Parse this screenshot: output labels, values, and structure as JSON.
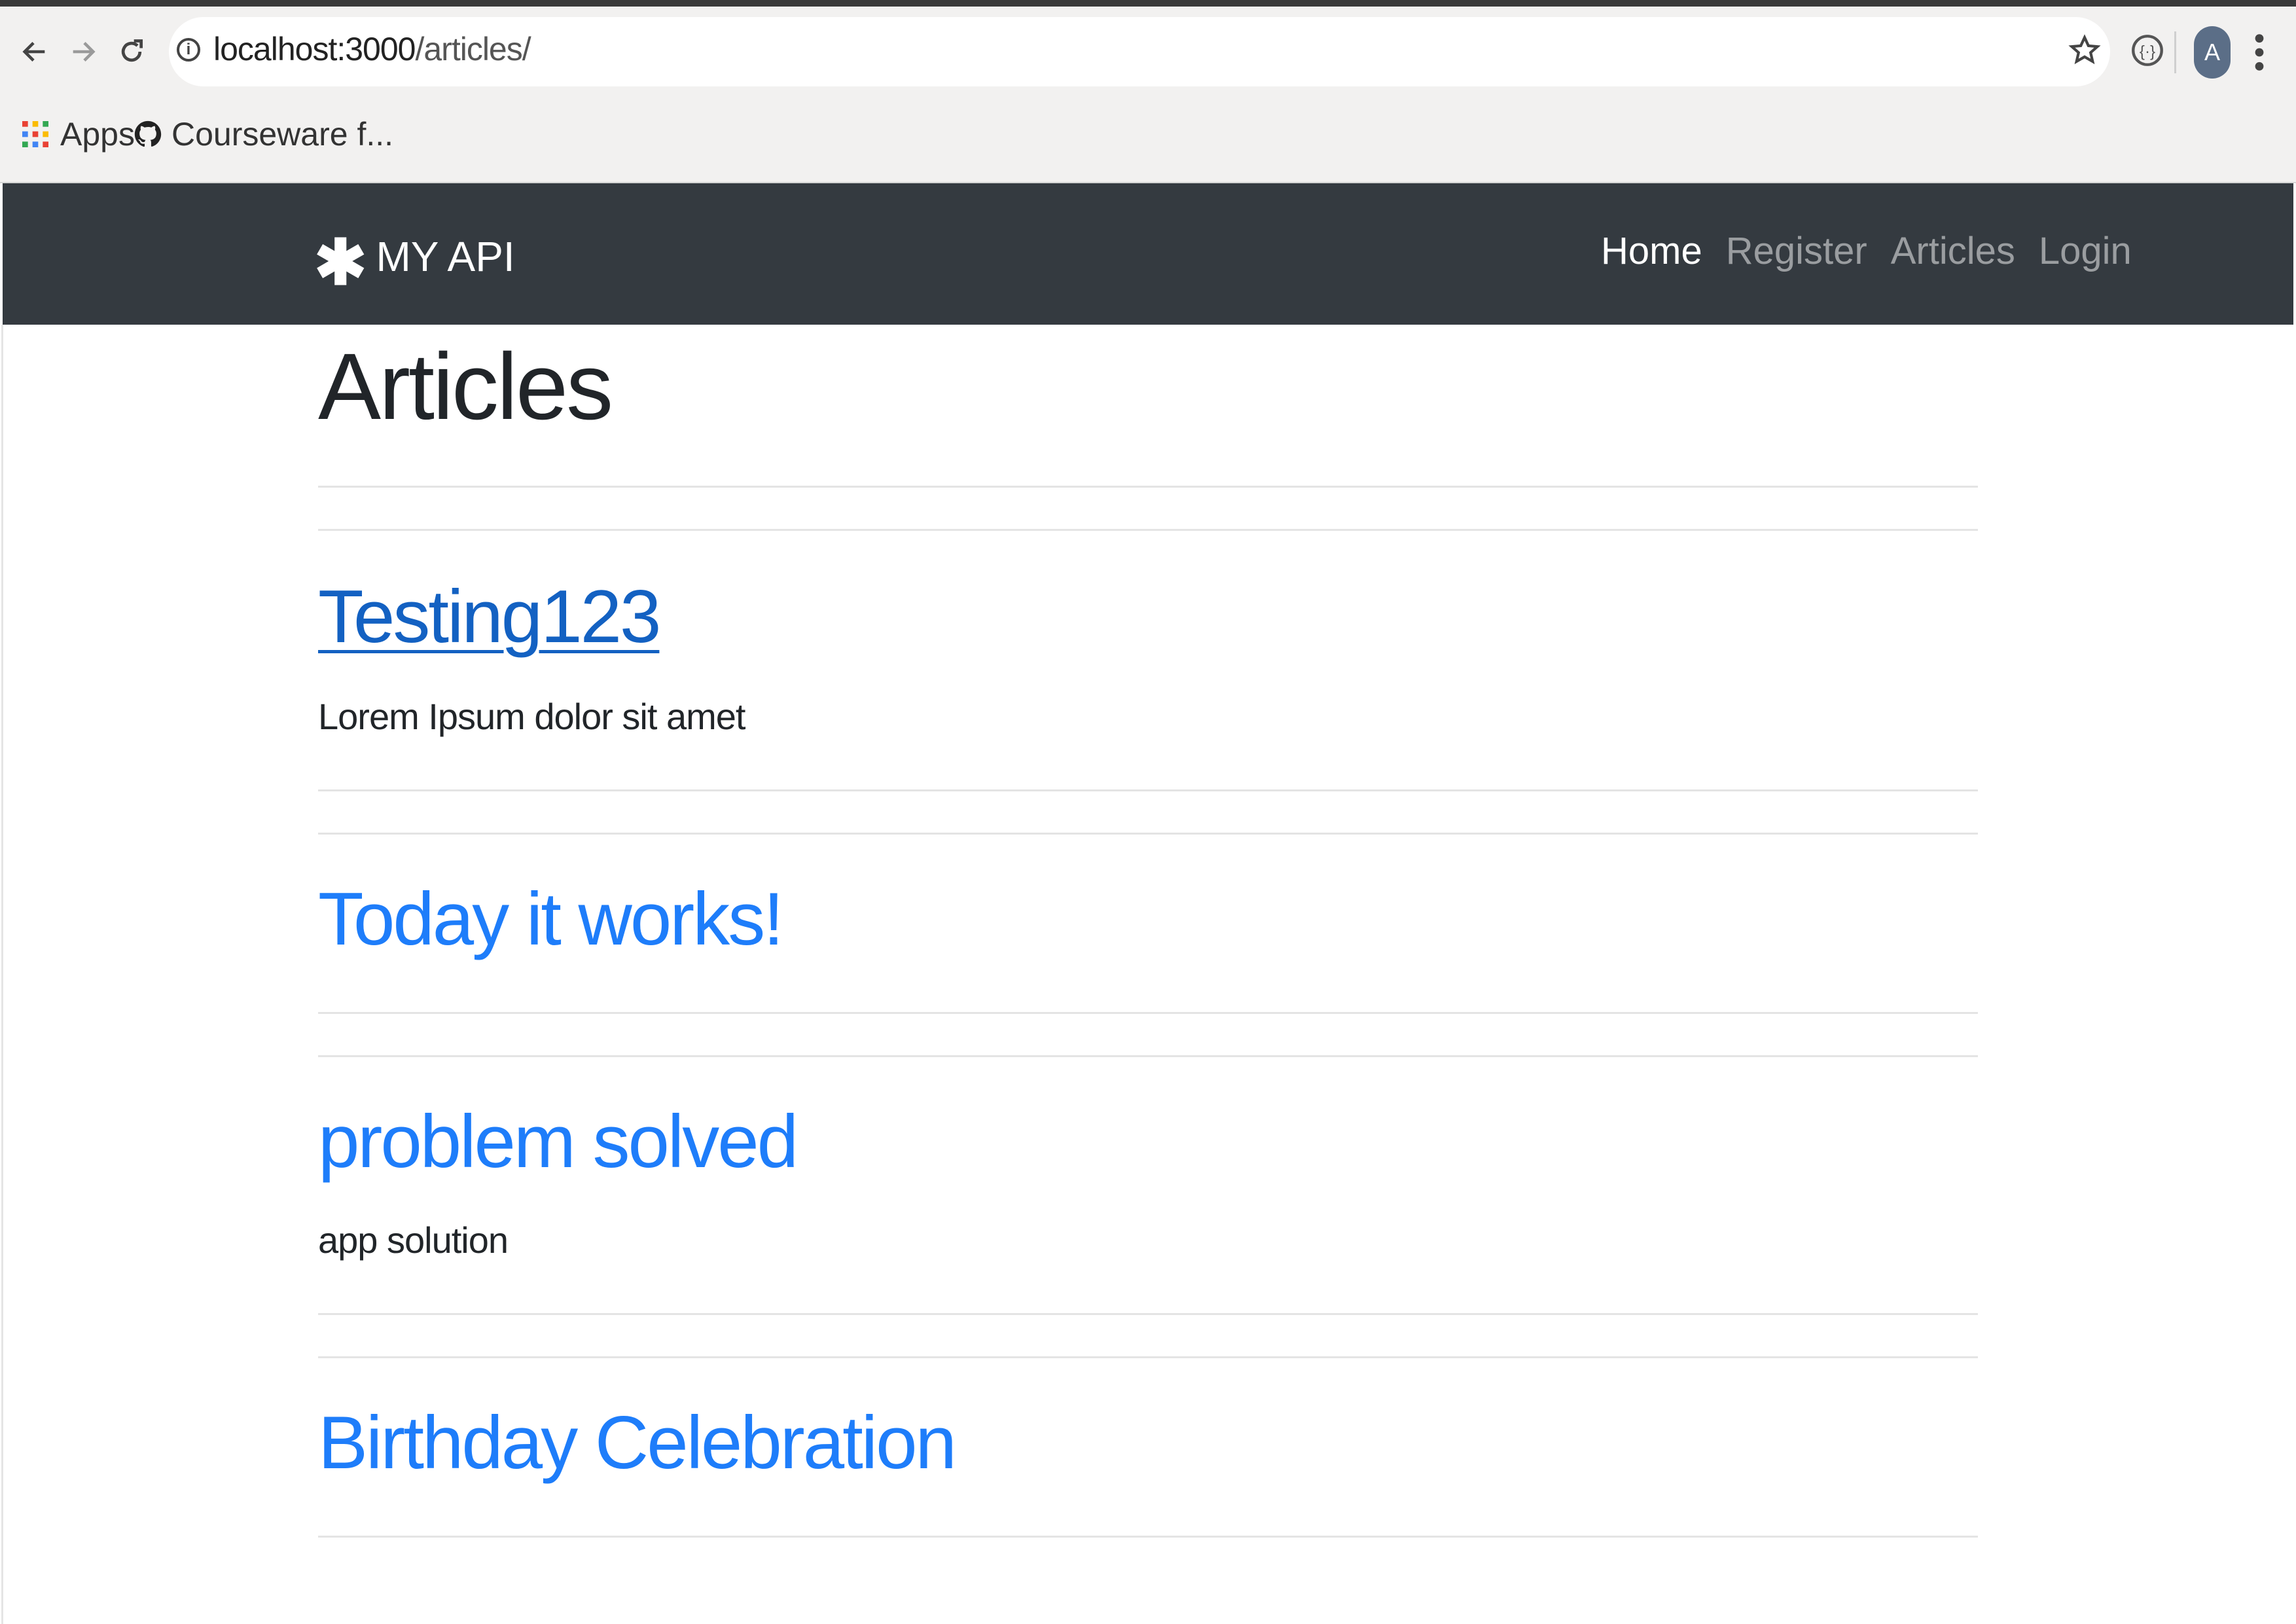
{
  "browser": {
    "url_host": "localhost:3000",
    "url_path": "/articles/",
    "bookmarks": [
      {
        "label": "Apps",
        "icon": "apps-grid-icon"
      },
      {
        "label": "Courseware f...",
        "icon": "github-icon"
      }
    ],
    "profile_initial": "A"
  },
  "navbar": {
    "brand_icon": "✱",
    "brand": "MY API",
    "links": [
      {
        "label": "Home",
        "active": true
      },
      {
        "label": "Register",
        "active": false
      },
      {
        "label": "Articles",
        "active": false
      },
      {
        "label": "Login",
        "active": false
      }
    ]
  },
  "page": {
    "title": "Articles"
  },
  "articles": [
    {
      "title": "Testing123",
      "body": "Lorem Ipsum dolor sit amet",
      "visited": true
    },
    {
      "title": "Today it works!",
      "body": "",
      "visited": false
    },
    {
      "title": "problem solved",
      "body": "app solution",
      "visited": false
    },
    {
      "title": "Birthday Celebration",
      "body": "",
      "visited": false
    }
  ],
  "colors": {
    "navbar_bg": "#343a40",
    "link": "#1e7dfa",
    "visited_link": "#1361c2",
    "text": "#212529"
  }
}
